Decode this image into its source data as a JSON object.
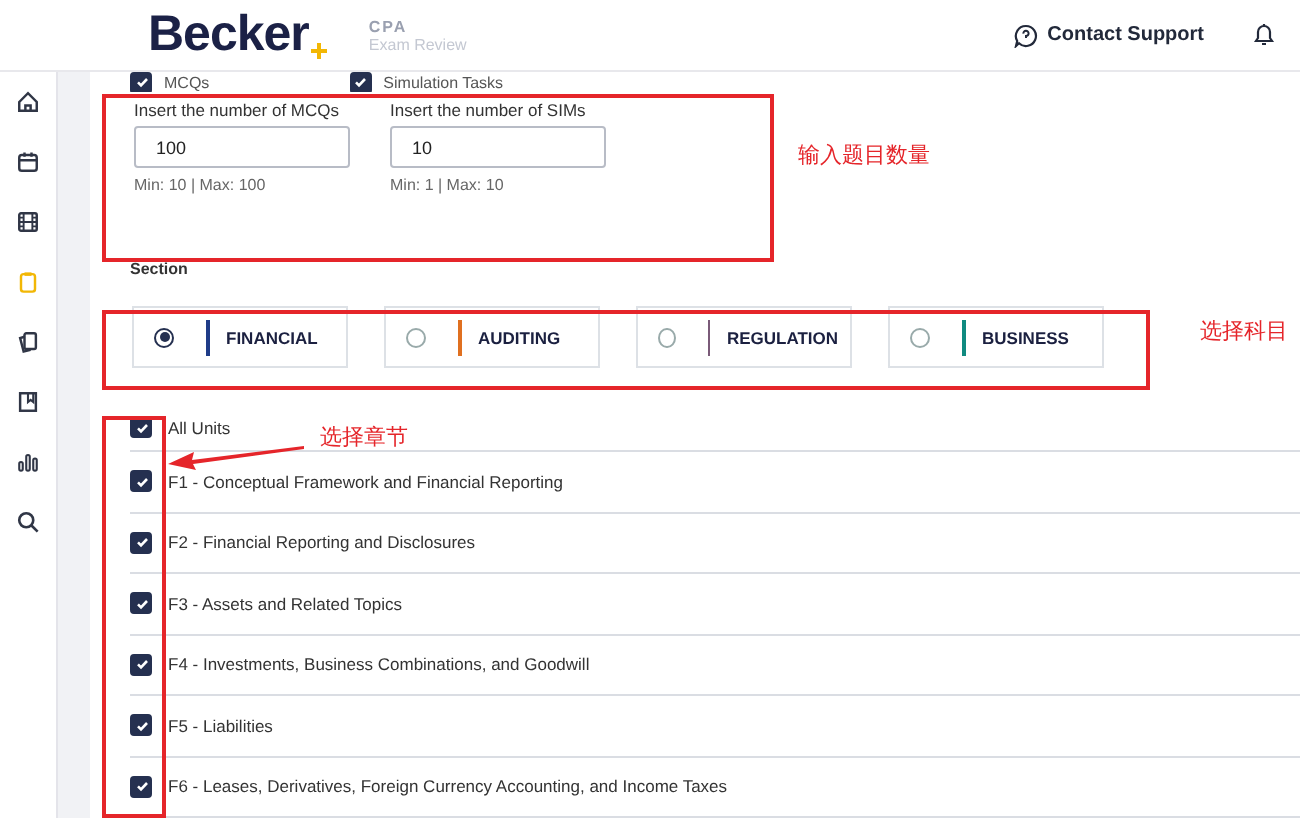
{
  "header": {
    "logo": "Becker",
    "logo_sub_top": "CPA",
    "logo_sub_bottom": "Exam Review",
    "contact": "Contact Support"
  },
  "sidebar": {
    "items": [
      {
        "selected": false
      },
      {
        "selected": false
      },
      {
        "selected": false
      },
      {
        "selected": true
      },
      {
        "selected": false
      },
      {
        "selected": false
      },
      {
        "selected": false
      },
      {
        "selected": false
      }
    ]
  },
  "question_types": [
    {
      "label": "MCQs",
      "checked": true
    },
    {
      "label": "Simulation Tasks",
      "checked": true
    }
  ],
  "inputs": [
    {
      "label": "Insert the number of MCQs",
      "value": "100",
      "hint": "Min: 10 | Max: 100"
    },
    {
      "label": "Insert the number of SIMs",
      "value": "10",
      "hint": "Min: 1 | Max: 10"
    }
  ],
  "section_label": "Section",
  "sections": [
    {
      "label": "FINANCIAL",
      "selected": true,
      "color": "#1f3c88"
    },
    {
      "label": "AUDITING",
      "selected": false,
      "color": "#e07020"
    },
    {
      "label": "REGULATION",
      "selected": false,
      "color": "#7a5a78"
    },
    {
      "label": "BUSINESS",
      "selected": false,
      "color": "#108a80"
    }
  ],
  "units": [
    {
      "label": "All Units",
      "checked": true
    },
    {
      "label": "F1 - Conceptual Framework and Financial Reporting",
      "checked": true
    },
    {
      "label": "F2 - Financial Reporting and Disclosures",
      "checked": true
    },
    {
      "label": "F3 - Assets and Related Topics",
      "checked": true
    },
    {
      "label": "F4 - Investments, Business Combinations, and Goodwill",
      "checked": true
    },
    {
      "label": "F5 - Liabilities",
      "checked": true
    },
    {
      "label": "F6 - Leases, Derivatives, Foreign Currency Accounting, and Income Taxes",
      "checked": true
    }
  ],
  "annotations": [
    {
      "text": "输入题目数量"
    },
    {
      "text": "选择科目"
    },
    {
      "text": "选择章节"
    }
  ]
}
